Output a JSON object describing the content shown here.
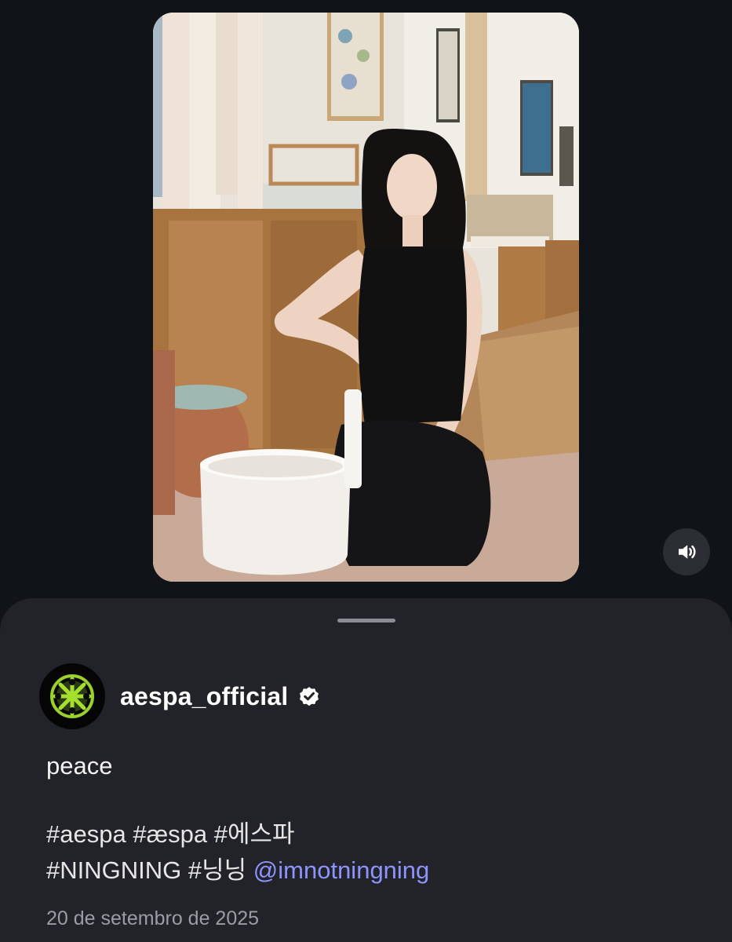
{
  "post": {
    "username": "aespa_official",
    "verified": true,
    "caption": "peace",
    "hashtags_line1": [
      "#aespa",
      "#æspa",
      "#에스파"
    ],
    "hashtags_line2": [
      "#NINGNING",
      "#닝닝"
    ],
    "mention_glyph": "@",
    "mention": "imnotningning",
    "date": "20 de setembro de 2025"
  },
  "media": {
    "type": "video",
    "sound_icon": "speaker-volume-icon"
  },
  "icons": {
    "verified": "verified-badge-icon",
    "avatar": "aespa-logo-icon"
  },
  "colors": {
    "background": "#101317",
    "sheet": "#212328",
    "mention": "#8f93ff",
    "date": "#9a9da3"
  }
}
